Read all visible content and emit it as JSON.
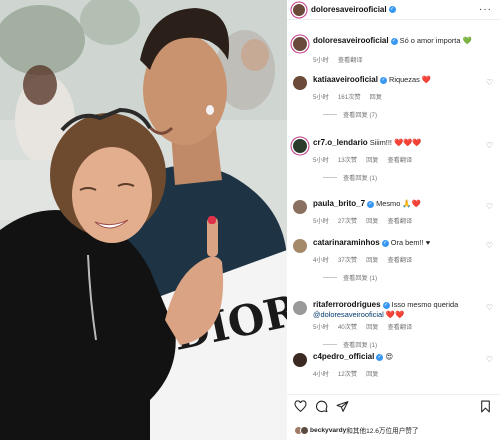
{
  "post": {
    "author": "doloresaveirooficial",
    "caption_author": "doloresaveirooficial",
    "caption": "Só o amor importa",
    "caption_emoji": "💚",
    "caption_time": "5小时",
    "translate": "查看翻译"
  },
  "comments": [
    {
      "user": "katiaaveirooficial",
      "verified": true,
      "text": "Riquezas",
      "emoji": "❤️",
      "time": "5小时",
      "likes": "161次赞",
      "reply": "回复",
      "replies_label": "查看回复 (7)",
      "avatar_color": "#6b4a3a"
    },
    {
      "user": "cr7.o_lendario",
      "verified": true,
      "text": "Siiim!!!",
      "emoji": "❤️❤️❤️",
      "time": "5小时",
      "likes": "13次赞",
      "reply": "回复",
      "translate": "查看翻译",
      "replies_label": "查看回复 (1)",
      "avatar_color": "#2c3c2a"
    },
    {
      "user": "paula_brito_7",
      "verified": true,
      "text": "Mesmo",
      "emoji": "🙏❤️",
      "time": "5小时",
      "likes": "27次赞",
      "reply": "回复",
      "translate": "查看翻译",
      "avatar_color": "#8a7060"
    },
    {
      "user": "catarinaraminhos",
      "verified": true,
      "text": "Ora bem!!",
      "emoji": "♥",
      "time": "4小时",
      "likes": "37次赞",
      "reply": "回复",
      "translate": "查看翻译",
      "replies_label": "查看回复 (1)",
      "avatar_color": "#a58a6a"
    },
    {
      "user": "ritaferrorodrigues",
      "verified": true,
      "text": "Isso mesmo querida",
      "mention": "@doloresaveirooficial",
      "emoji": "❤️❤️",
      "time": "5小时",
      "likes": "40次赞",
      "reply": "回复",
      "translate": "查看翻译",
      "replies_label": "查看回复 (1)",
      "avatar_color": "#9a9a9a"
    },
    {
      "user": "c4pedro_official",
      "verified": true,
      "text": "",
      "emoji": "😍",
      "time": "4小时",
      "likes": "12次赞",
      "reply": "回复",
      "avatar_color": "#3a2a22"
    }
  ],
  "liked_by": {
    "user": "beckyvardy",
    "suffix": "和其他12.6万位用户赞了"
  },
  "icons": [
    "heart-icon",
    "comment-icon",
    "share-icon",
    "bookmark-icon",
    "more-icon",
    "verified-badge-icon"
  ],
  "colors": {
    "verified": "#3897f0",
    "story_ring": "#c13584",
    "muted": "#737373"
  }
}
